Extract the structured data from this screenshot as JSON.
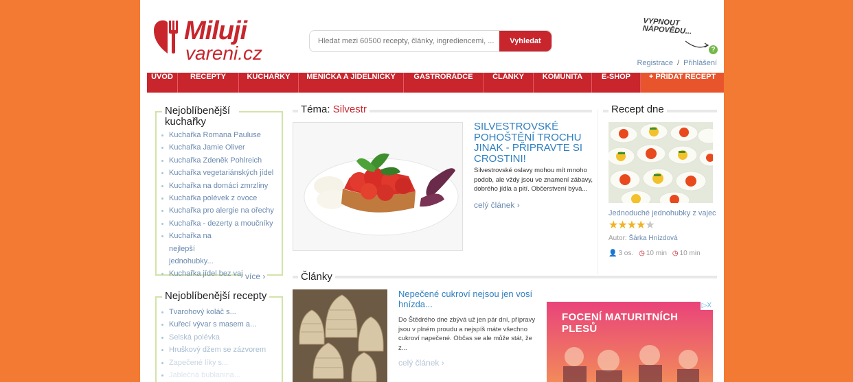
{
  "logo": {
    "line1": "Miluji",
    "line2": "vareni.cz"
  },
  "search": {
    "placeholder": "Hledat mezi 60500 recepty, články, ingrediencemi, ...",
    "button": "Vyhledat"
  },
  "help": {
    "line1": "VYPNOUT",
    "line2": "NÁPOVĚDU...",
    "q": "?"
  },
  "auth": {
    "register": "Registrace",
    "sep": "/",
    "login": "Přihlášení"
  },
  "nav": [
    "ÚVOD",
    "RECEPTY",
    "KUCHAŘKY",
    "MENIČKA A JÍDELNÍČKY",
    "GASTRORÁDCE",
    "ČLÁNKY",
    "KOMUNITA",
    "E-SHOP",
    "+ PŘIDAT RECEPT"
  ],
  "cookbooks": {
    "title": "Nejoblíbenější kuchařky",
    "items": [
      "Kuchařka Romana Pauluse",
      "Kuchařka Jamie Oliver",
      "Kuchařka Zdeněk Pohlreich",
      "Kuchařka vegetariánských jídel",
      "Kuchařka na domácí zmrzliny",
      "Kuchařka polévek z ovoce",
      "Kuchařka pro alergie na ořechy",
      "Kuchařka - dezerty a moučníky",
      "Kuchařka na nejlepší jednohubky...",
      "Kuchařka jídel bez vajec"
    ],
    "more": "více ›"
  },
  "recipes": {
    "title": "Nejoblíbenější recepty",
    "items": [
      "Tvarohový koláč s...",
      "Kuřecí vývar s masem a...",
      "Selská polévka",
      "Hruškový džem se zázvorem",
      "Zapečené líky s...",
      "Jablečná bublanina..."
    ]
  },
  "theme": {
    "label": "Téma:",
    "name": "Silvestr",
    "article_title": "SILVESTROVSKÉ POHOŠTĚNÍ TROCHU JINAK - PŘIPRAVTE SI CROSTINI!",
    "article_text": "Silvestrovské oslavy mohou mít mnoho podob, ale vždy jsou ve znamení zábavy, dobrého jídla a pití. Občerstvení bývá...",
    "more": "celý článek ›"
  },
  "recipe_of_day": {
    "title": "Recept dne",
    "name": "Jednoduché jednohubky z vajec",
    "stars_on": "★★★★",
    "stars_off": "★",
    "rating": 4,
    "author_label": "Autor:",
    "author": "Šárka Hnízdová",
    "portions": "3 os.",
    "time1": "10 min",
    "time2": "10 min"
  },
  "articles": {
    "title": "Články",
    "item_title": "Nepečené cukroví nejsou jen vosí hnízda...",
    "item_text": "Do Štědrého dne zbývá už jen pár dní, přípravy jsou v plném proudu a nejspíš máte všechno cukroví napečené. Občas se ale může stát, že z...",
    "more": "celý článek ›"
  },
  "ad": {
    "text": "FOCENÍ MATURITNÍCH PLESŮ",
    "badge": "▷X"
  },
  "colors": {
    "background": "#f37a32",
    "brand_red": "#c8252d",
    "link_blue": "#2e7fc1",
    "box_green": "#d2e3a8"
  }
}
